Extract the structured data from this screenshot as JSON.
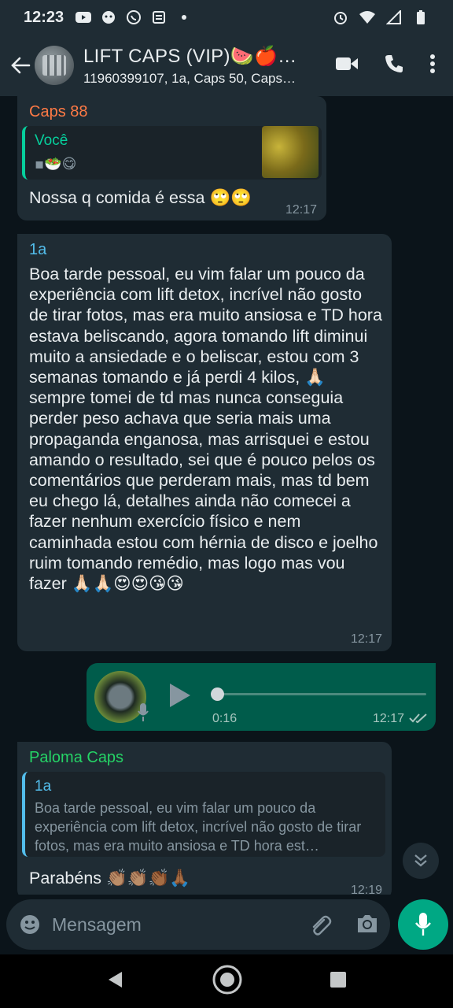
{
  "status_bar": {
    "time": "12:23"
  },
  "header": {
    "title": "LIFT CAPS  (VIP)🍉🍎…",
    "subtitle": "11960399107, 1a, Caps 50, Caps…"
  },
  "messages": [
    {
      "sender": "Caps 88",
      "quote_name": "Você",
      "quote_emoji": "▪🥗😋",
      "text": "Nossa q comida é essa 🙄🙄",
      "time": "12:17"
    },
    {
      "sender": "1a",
      "text": "Boa tarde pessoal, eu vim falar um pouco da experiência com lift detox, incrível não gosto de tirar fotos, mas era muito ansiosa e TD hora estava beliscando, agora tomando lift diminui muito a ansiedade e o beliscar, estou com 3 semanas tomando e já perdi 4 kilos, 🙏🏻 sempre tomei de td mas nunca conseguia perder peso achava que seria mais uma propaganda enganosa, mas arrisquei e estou amando o resultado, sei que é pouco pelos os comentários que perderam mais, mas td bem eu chego lá, detalhes ainda não comecei a fazer nenhum exercício físico e nem caminhada estou com hérnia de disco e joelho ruim tomando remédio, mas logo mas vou fazer 🙏🏻🙏🏻😍😍😘😘",
      "time": "12:17"
    },
    {
      "audio_duration": "0:16",
      "time": "12:17"
    },
    {
      "sender": "Paloma Caps",
      "quote_name": "1a",
      "quote_text": "Boa tarde pessoal, eu vim falar um pouco da experiência com lift detox, incrível não gosto de tirar fotos, mas era muito ansiosa e TD hora est…",
      "text": "Parabéns 👏🏽👏🏽👏🏾🙏🏾",
      "time": "12:19"
    }
  ],
  "input": {
    "placeholder": "Mensagem"
  },
  "colors": {
    "header_bg": "#1f2c34",
    "chat_bg": "#0b141a",
    "incoming_bubble": "#1f2c34",
    "outgoing_bubble": "#005c4b",
    "accent": "#00a884",
    "sender_caps88": "#ff7a45",
    "sender_1a": "#53bdeb",
    "sender_paloma": "#25d366"
  }
}
